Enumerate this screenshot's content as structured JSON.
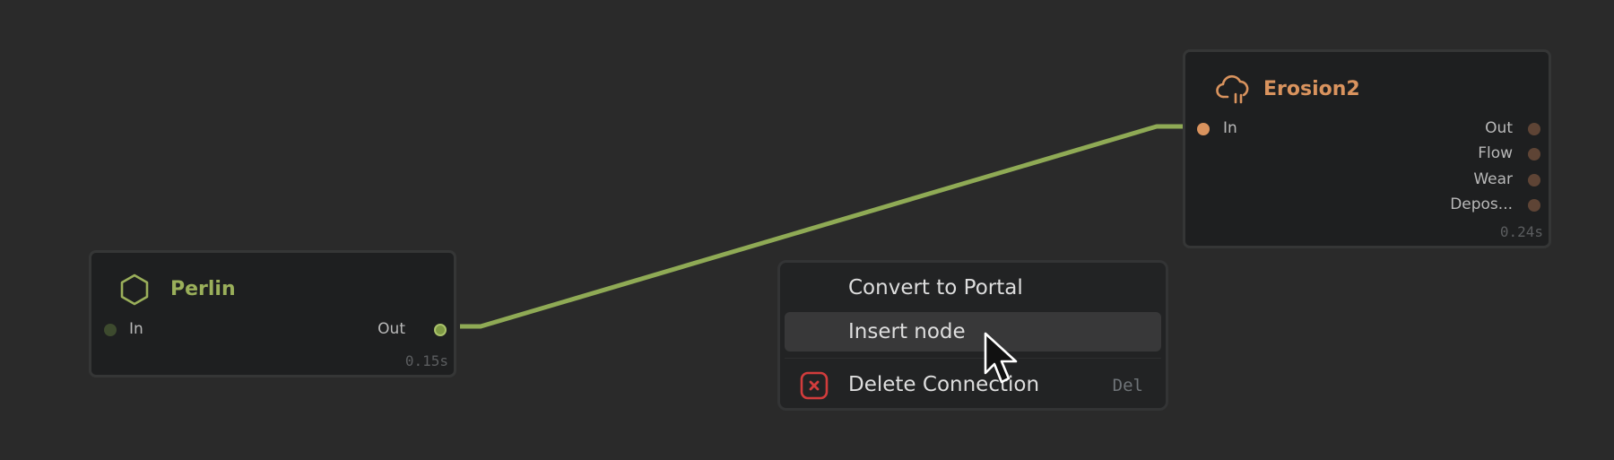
{
  "colors": {
    "background": "#2a2a2a",
    "wire": "#8faa55",
    "perlin_accent": "#9aaf5a",
    "erosion_accent": "#d9935e",
    "danger": "#d23c3c"
  },
  "nodes": {
    "perlin": {
      "icon": "hexagon-icon",
      "title": "Perlin",
      "inputs": [
        "In"
      ],
      "outputs": [
        "Out"
      ],
      "timing": "0.15s"
    },
    "erosion": {
      "icon": "cloud-rain-icon",
      "title": "Erosion2",
      "inputs": [
        "In"
      ],
      "outputs": [
        "Out",
        "Flow",
        "Wear",
        "Depos..."
      ],
      "timing": "0.24s"
    }
  },
  "context_menu": {
    "items": [
      {
        "label": "Convert to Portal"
      },
      {
        "label": "Insert node",
        "hovered": true
      },
      {
        "label": "Delete Connection",
        "shortcut": "Del",
        "icon": "delete-x-icon"
      }
    ]
  },
  "cursor": {
    "icon": "arrow-cursor-icon"
  }
}
